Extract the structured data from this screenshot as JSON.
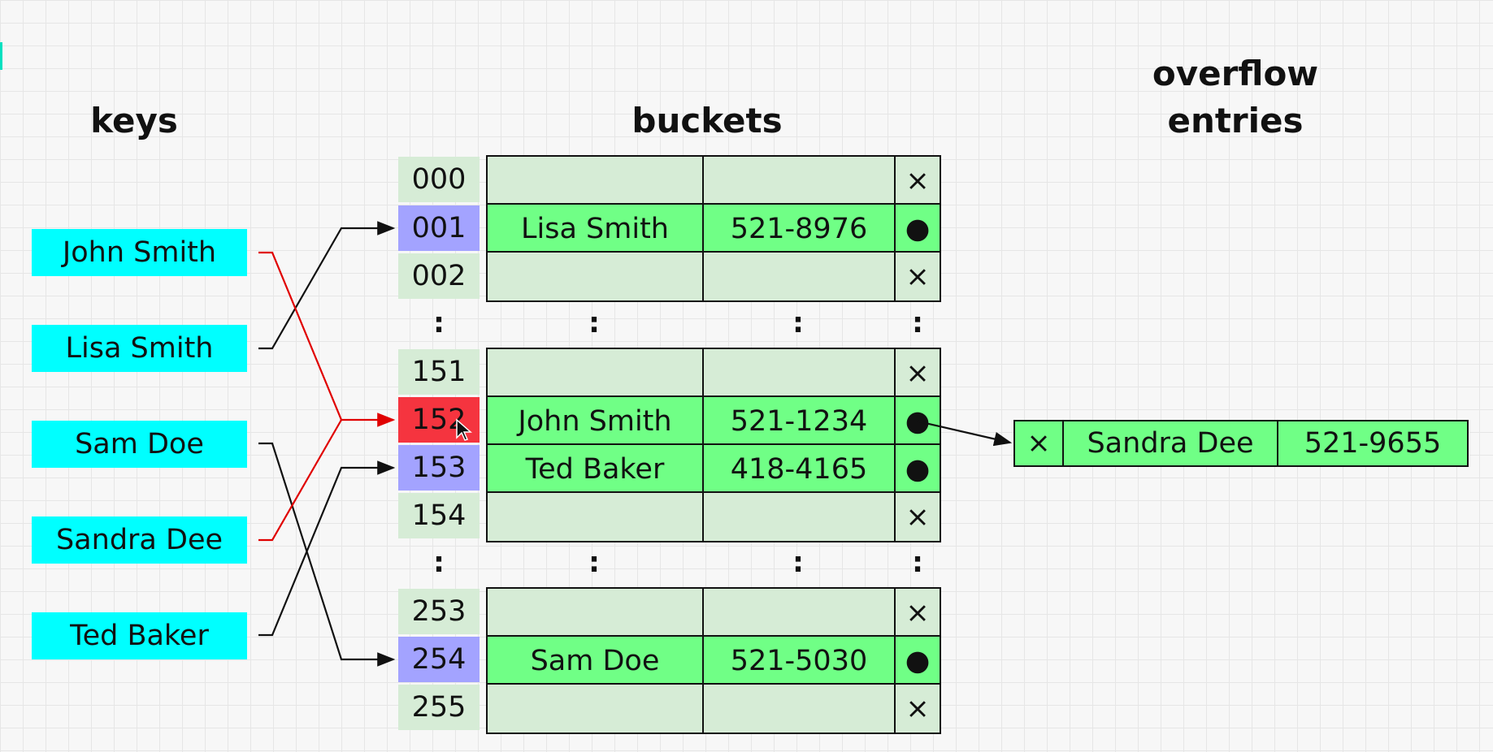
{
  "headings": {
    "keys": "keys",
    "buckets": "buckets",
    "overflow_line1": "overflow",
    "overflow_line2": "entries"
  },
  "keys": [
    "John Smith",
    "Lisa Smith",
    "Sam Doe",
    "Sandra Dee",
    "Ted Baker"
  ],
  "indices": [
    "000",
    "001",
    "002",
    "151",
    "152",
    "153",
    "154",
    "253",
    "254",
    "255"
  ],
  "ellipsis": ":",
  "buckets": {
    "b001": {
      "name": "Lisa Smith",
      "phone": "521-8976"
    },
    "b152": {
      "name": "John Smith",
      "phone": "521-1234"
    },
    "b153": {
      "name": "Ted Baker",
      "phone": "418-4165"
    },
    "b254": {
      "name": "Sam Doe",
      "phone": "521-5030"
    }
  },
  "markers": {
    "null": "×",
    "pointer": "●"
  },
  "overflow": {
    "name": "Sandra Dee",
    "phone": "521-9655"
  },
  "colors": {
    "key_bg": "#00ffff",
    "index_bg": "#d6ecd6",
    "index_highlight": "#a3a3ff",
    "index_collision": "#f5343f",
    "entry_bg": "#70ff86",
    "empty_bg": "#d6ecd6",
    "collision_arrow": "#e00000",
    "arrow": "#111111"
  }
}
